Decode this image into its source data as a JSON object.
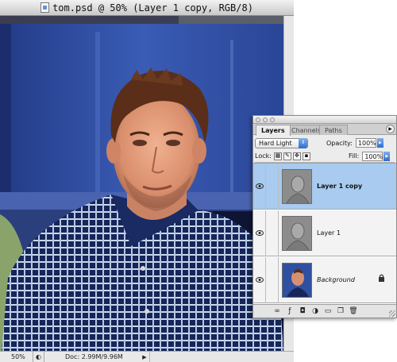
{
  "document": {
    "title": "tom.psd @ 50% (Layer 1 copy, RGB/8)",
    "zoom": "50%",
    "doc_size": "Doc: 2.99M/9.96M"
  },
  "layers_palette": {
    "tabs": [
      {
        "label": "Layers",
        "active": true
      },
      {
        "label": "Channels",
        "active": false
      },
      {
        "label": "Paths",
        "active": false
      }
    ],
    "blend_mode": "Hard Light",
    "opacity_label": "Opacity:",
    "opacity_value": "100%",
    "lock_label": "Lock:",
    "fill_label": "Fill:",
    "fill_value": "100%",
    "layers": [
      {
        "name": "Layer 1 copy",
        "selected": true,
        "visible": true
      },
      {
        "name": "Layer 1",
        "selected": false,
        "visible": true
      },
      {
        "name": "Background",
        "selected": false,
        "visible": true,
        "locked": true
      }
    ]
  },
  "colors": {
    "selection": "#a8cbef",
    "photo_blue": "#2f4fa0",
    "shirt_navy": "#16265a"
  }
}
